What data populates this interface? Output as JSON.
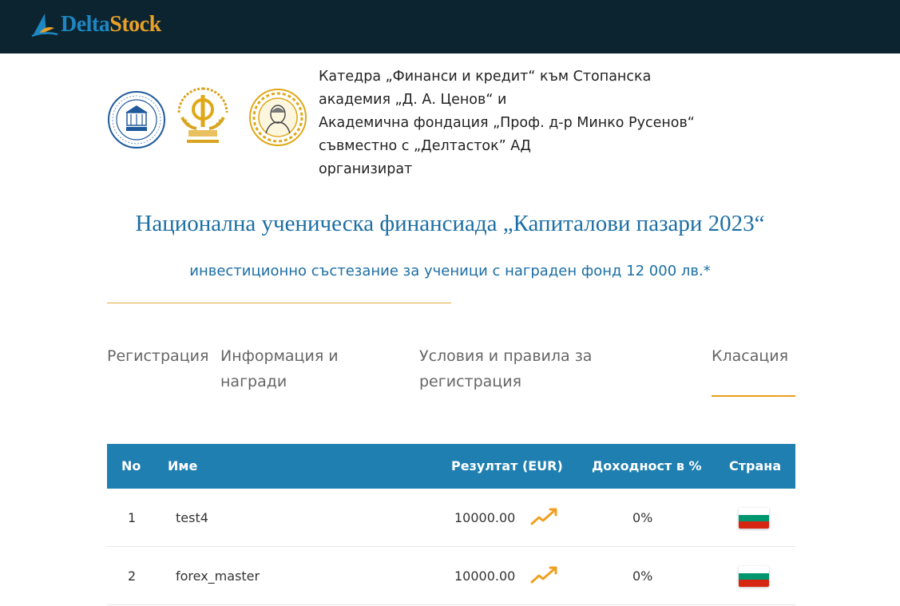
{
  "brand": {
    "delta": "Delta",
    "stock": "Stock",
    "colors": {
      "delta": "#1e86c0",
      "stock": "#e8a028",
      "header_bg": "#0b2430"
    }
  },
  "intro": [
    "Катедра „Финанси и кредит“ към Стопанска",
    "академия „Д. А. Ценов“ и",
    "Академична фондация „Проф. д-р Минко Русенов“",
    "съвместно с „Делтасток” АД",
    "организират"
  ],
  "title": "Национална ученическа финансиада „Капиталови пазари 2023“",
  "subtitle": "инвестиционно състезание за ученици с награден фонд 12 000 лв.*",
  "tabs": [
    {
      "lines": [
        "Регистрация"
      ]
    },
    {
      "lines": [
        "Информация и",
        "награди"
      ]
    },
    {
      "lines": [
        "Условия и правила за",
        "регистрация"
      ]
    },
    {
      "lines": [
        "Класация"
      ],
      "active": true
    }
  ],
  "table": {
    "headers": {
      "no": "No",
      "name": "Име",
      "result": "Резултат (EUR)",
      "yield": "Доходност в %",
      "country": "Страна"
    },
    "rows": [
      {
        "no": "1",
        "name": "test4",
        "result": "10000.00",
        "yield": "0%",
        "trend_icon": "trend-up-icon",
        "flag": "bulgaria-flag"
      },
      {
        "no": "2",
        "name": "forex_master",
        "result": "10000.00",
        "yield": "0%",
        "trend_icon": "trend-up-icon",
        "flag": "bulgaria-flag"
      }
    ],
    "colors": {
      "header_bg": "#1f7fb0",
      "trend": "#f0a020"
    }
  }
}
